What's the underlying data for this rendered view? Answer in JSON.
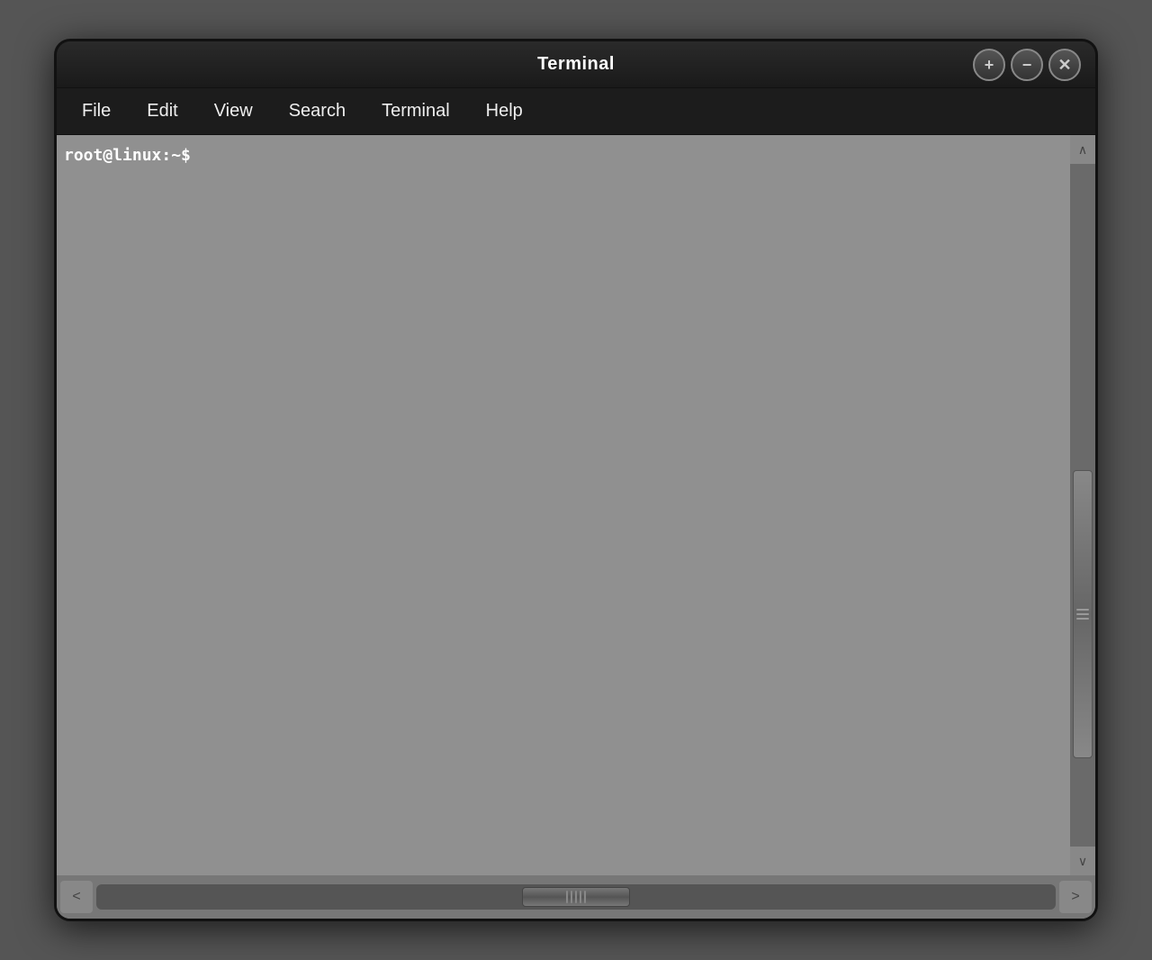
{
  "window": {
    "title": "Terminal",
    "controls": {
      "add_label": "+",
      "minimize_label": "−",
      "close_label": "✕"
    }
  },
  "menubar": {
    "items": [
      {
        "id": "file",
        "label": "File"
      },
      {
        "id": "edit",
        "label": "Edit"
      },
      {
        "id": "view",
        "label": "View"
      },
      {
        "id": "search",
        "label": "Search"
      },
      {
        "id": "terminal",
        "label": "Terminal"
      },
      {
        "id": "help",
        "label": "Help"
      }
    ]
  },
  "terminal": {
    "prompt": "root@linux:~$"
  },
  "colors": {
    "background": "#1a1a1a",
    "terminal_bg": "#909090",
    "menubar_bg": "#1c1c1c",
    "scrollbar_bg": "#777"
  }
}
